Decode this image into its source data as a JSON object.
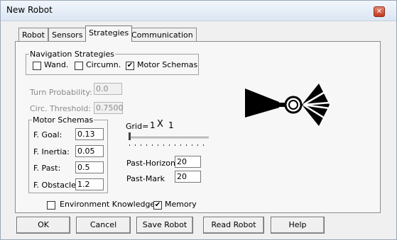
{
  "window": {
    "title": "New Robot"
  },
  "tabs": [
    {
      "label": "Robot"
    },
    {
      "label": "Sensors"
    },
    {
      "label": "Strategies"
    },
    {
      "label": "Communication"
    }
  ],
  "navigation": {
    "legend": "Navigation Strategies",
    "wander": {
      "label": "Wand.",
      "checked": false
    },
    "circumnavigate": {
      "label": "Circumn.",
      "checked": false
    },
    "motor_schemas": {
      "label": "Motor Schemas",
      "checked": true
    }
  },
  "turn_probability": {
    "label": "Turn Probability:",
    "value": "0.0"
  },
  "circ_threshold": {
    "label": "Circ. Threshold:",
    "value": "0.7500"
  },
  "motor_schemas": {
    "legend": "Motor Schemas",
    "goal": {
      "label": "F. Goal:",
      "value": "0.13"
    },
    "inertia": {
      "label": "F. Inertia:",
      "value": "0.05"
    },
    "past": {
      "label": "F. Past:",
      "value": "0.5"
    },
    "obstacle": {
      "label": "F. Obstacle:",
      "value": "1.2"
    }
  },
  "grid": {
    "label": "Grid=",
    "rows": "1",
    "times": "X",
    "cols": "1",
    "slider_value": 0
  },
  "past_horizon": {
    "label": "Past-Horizon",
    "value": "20"
  },
  "past_mark": {
    "label": "Past-Mark",
    "value": "20"
  },
  "environment_knowledge": {
    "label": "Environment Knowledge",
    "checked": false
  },
  "memory": {
    "label": "Memory",
    "checked": true
  },
  "buttons": {
    "ok": "OK",
    "cancel": "Cancel",
    "save": "Save Robot",
    "read": "Read Robot",
    "help": "Help"
  },
  "icons": {
    "close": "close-icon",
    "robot": "robot-sensor-icon",
    "check_mark": "✔"
  },
  "colors": {
    "close_button": "#c2381d",
    "robot": "#000000"
  }
}
